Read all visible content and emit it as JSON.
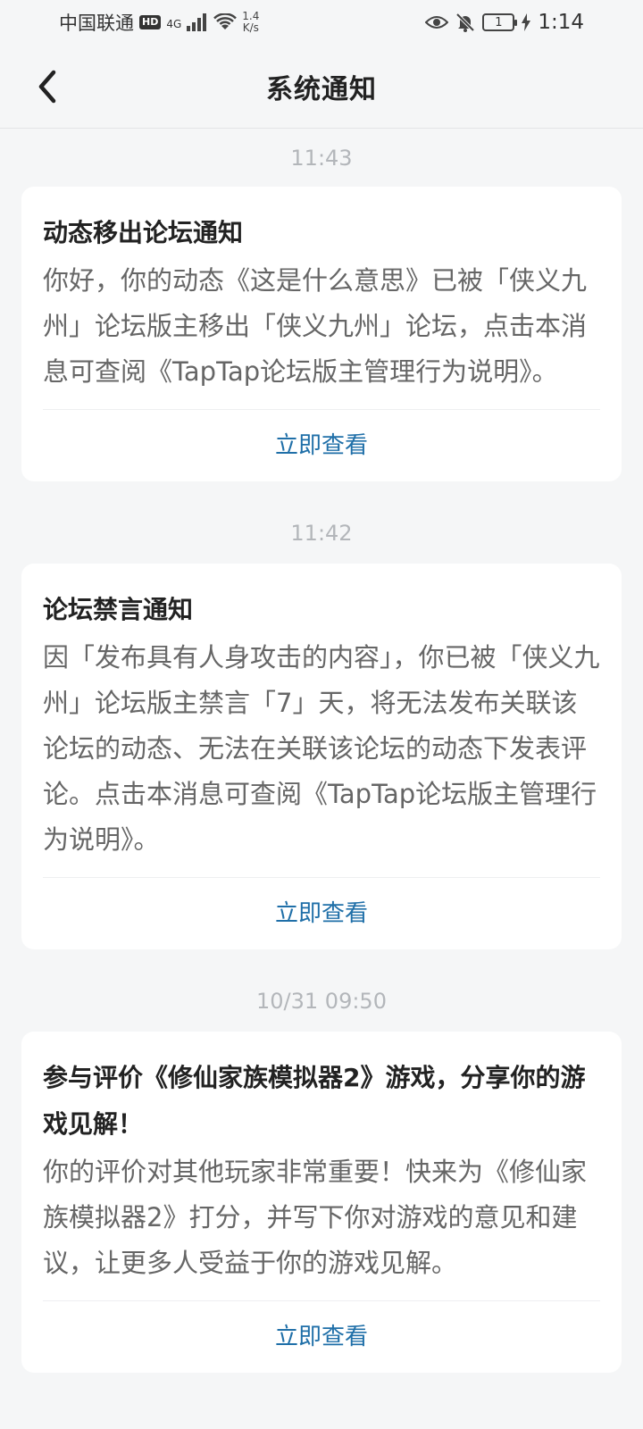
{
  "status_bar": {
    "carrier": "中国联通",
    "hd": "HD",
    "network": "4G",
    "speed_value": "1.4",
    "speed_unit": "K/s",
    "battery_level": "1",
    "time": "1:14"
  },
  "header": {
    "title": "系统通知"
  },
  "notifications": [
    {
      "time": "11:43",
      "title": "动态移出论坛通知",
      "body": "你好，你的动态《这是什么意思》已被「侠义九州」论坛版主移出「侠义九州」论坛，点击本消息可查阅《TapTap论坛版主管理行为说明》。",
      "action": "立即查看"
    },
    {
      "time": "11:42",
      "title": "论坛禁言通知",
      "body": "因「发布具有人身攻击的内容」，你已被「侠义九州」论坛版主禁言「7」天，将无法发布关联该论坛的动态、无法在关联该论坛的动态下发表评论。点击本消息可查阅《TapTap论坛版主管理行为说明》。",
      "action": "立即查看"
    },
    {
      "time": "10/31  09:50",
      "title": "参与评价《修仙家族模拟器2》游戏，分享你的游戏见解！",
      "body": "你的评价对其他玩家非常重要！快来为《修仙家族模拟器2》打分，并写下你对游戏的意见和建议，让更多人受益于你的游戏见解。",
      "action": "立即查看"
    }
  ],
  "colors": {
    "background": "#f5f6f7",
    "card": "#ffffff",
    "link": "#1f6fa8",
    "timestamp": "#b3b6ba"
  }
}
